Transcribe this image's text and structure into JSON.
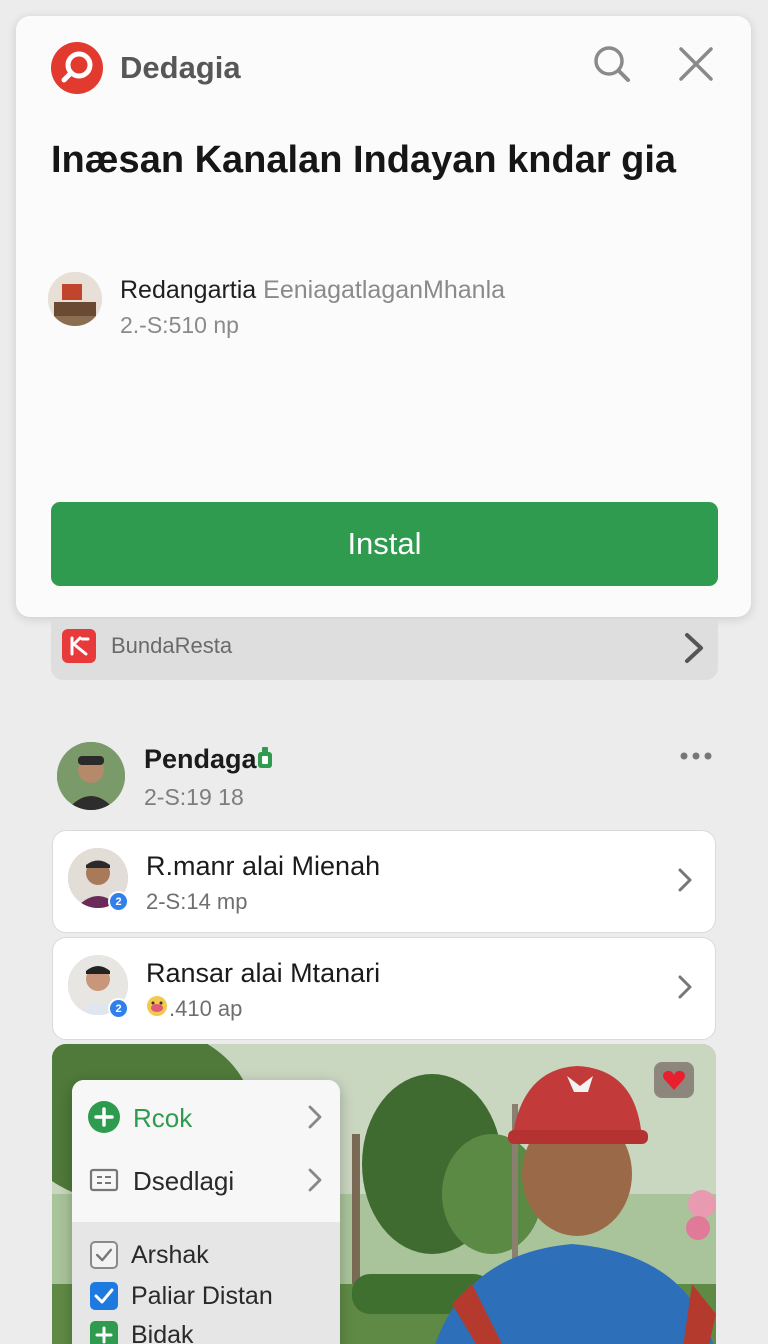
{
  "card": {
    "brand_name": "Dedagia",
    "title": "Inæsan Kanalan Indayan kndar gia",
    "publisher_name": "Redangartia",
    "publisher_extra": "EeniagatlaganMhanla",
    "publisher_meta": "2.-S:510  np",
    "install_label": "Instal"
  },
  "bunda_row": {
    "label": "BundaResta"
  },
  "post": {
    "author": "Pendaga",
    "time": "2-S:19  18"
  },
  "list": [
    {
      "title": "R.manr alai Mienah",
      "subtitle": "2-S:14  mp",
      "badge": "2"
    },
    {
      "title": "Ransar alai Mtanari",
      "subtitle": ".410  ap",
      "badge": "2"
    }
  ],
  "menu": {
    "items": [
      {
        "label": "Rcok",
        "icon": "plus-circle-icon"
      },
      {
        "label": "Dsedlagi",
        "icon": "list-box-icon"
      }
    ],
    "checks": [
      {
        "label": "Arshak",
        "state": "checked-plain"
      },
      {
        "label": "Paliar Distan",
        "state": "checked-blue"
      },
      {
        "label": "Bidak",
        "state": "plus-green"
      }
    ]
  },
  "colors": {
    "install_green": "#2e9b4e",
    "brand_red": "#e23a2e",
    "verified_blue": "#2f80ed"
  }
}
